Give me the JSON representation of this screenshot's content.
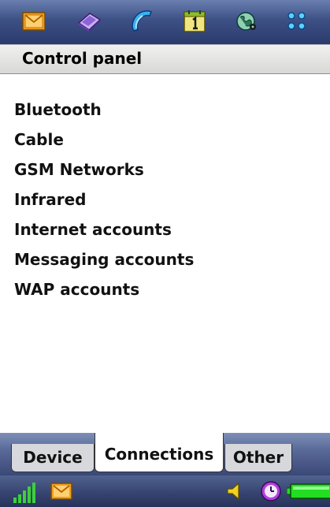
{
  "top_bar": {
    "icons": [
      "messaging-icon",
      "contacts-icon",
      "phone-icon",
      "calendar-icon",
      "internet-icon",
      "main-menu-icon"
    ]
  },
  "title_bar": {
    "title": "Control panel"
  },
  "list": {
    "items": [
      {
        "label": "Bluetooth"
      },
      {
        "label": "Cable"
      },
      {
        "label": "GSM Networks"
      },
      {
        "label": "Infrared"
      },
      {
        "label": "Internet accounts"
      },
      {
        "label": "Messaging accounts"
      },
      {
        "label": "WAP accounts"
      }
    ]
  },
  "tabs": {
    "items": [
      {
        "label": "Device",
        "active": false
      },
      {
        "label": "Connections",
        "active": true
      },
      {
        "label": "Other",
        "active": false
      }
    ]
  },
  "status_bar": {
    "icons": [
      "signal-strength-icon",
      "new-message-icon",
      "volume-icon",
      "clock-icon",
      "battery-icon"
    ],
    "signal_bars_level": 5,
    "battery_level_fraction": 1.0
  },
  "colors": {
    "bar_dark": "#2a3a6c",
    "tab_active_bg": "#ffffff",
    "tab_inactive_bg": "#d6d8dc",
    "signal_green": "#3bd03b",
    "battery_green": "#22dd22",
    "envelope_orange": "#f0a020"
  }
}
